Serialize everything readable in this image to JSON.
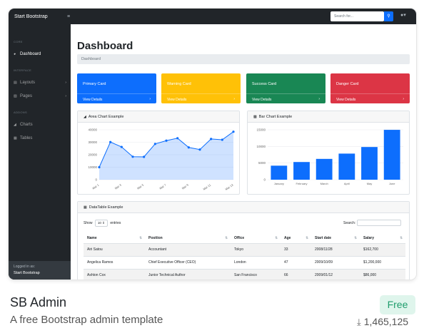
{
  "app": {
    "brand": "Start Bootstrap",
    "toggle_icon": "hamburger-icon",
    "search_placeholder": "Search for...",
    "search_icon": "search-icon",
    "user_icon": "user-icon"
  },
  "sidebar": {
    "sections": [
      {
        "heading": "Core",
        "items": [
          {
            "label": "Dashboard",
            "icon": "tachometer-icon",
            "active": true
          }
        ]
      },
      {
        "heading": "Interface",
        "items": [
          {
            "label": "Layouts",
            "icon": "columns-icon"
          },
          {
            "label": "Pages",
            "icon": "book-icon"
          }
        ]
      },
      {
        "heading": "Addons",
        "items": [
          {
            "label": "Charts",
            "icon": "chart-area-icon"
          },
          {
            "label": "Tables",
            "icon": "table-icon"
          }
        ]
      }
    ],
    "footer_label": "Logged in as:",
    "footer_value": "Start Bootstrap"
  },
  "main": {
    "title": "Dashboard",
    "breadcrumb": "Dashboard",
    "cards": [
      {
        "title": "Primary Card",
        "link": "View Details",
        "color": "#0d6efd"
      },
      {
        "title": "Warning Card",
        "link": "View Details",
        "color": "#ffc107"
      },
      {
        "title": "Success Card",
        "link": "View Details",
        "color": "#198754"
      },
      {
        "title": "Danger Card",
        "link": "View Details",
        "color": "#dc3545"
      }
    ],
    "area_title": "Area Chart Example",
    "bar_title": "Bar Chart Example",
    "table_title": "DataTable Example",
    "show_label": "Show",
    "entries_value": "10",
    "entries_label": "entries",
    "search_label": "Search:",
    "columns": [
      "Name",
      "Position",
      "Office",
      "Age",
      "Start date",
      "Salary"
    ],
    "rows": [
      [
        "Airi Satou",
        "Accountant",
        "Tokyo",
        "33",
        "2008/11/28",
        "$162,700"
      ],
      [
        "Angelica Ramos",
        "Chief Executive Officer (CEO)",
        "London",
        "47",
        "2009/10/09",
        "$1,200,000"
      ],
      [
        "Ashton Cox",
        "Junior Technical Author",
        "San Francisco",
        "66",
        "2009/01/12",
        "$86,000"
      ]
    ]
  },
  "listing": {
    "title": "SB Admin",
    "subtitle": "A free Bootstrap admin template",
    "badge": "Free",
    "downloads": "1,465,125",
    "download_icon": "download-icon"
  },
  "chart_data": [
    {
      "type": "area",
      "title": "Area Chart Example",
      "x": [
        "Mar 1",
        "Mar 2",
        "Mar 3",
        "Mar 4",
        "Mar 5",
        "Mar 6",
        "Mar 7",
        "Mar 8",
        "Mar 9",
        "Mar 10",
        "Mar 11",
        "Mar 12",
        "Mar 13"
      ],
      "x_tick_labels": [
        "Mar 1",
        "Mar 3",
        "Mar 5",
        "Mar 7",
        "Mar 9",
        "Mar 11",
        "Mar 13"
      ],
      "values": [
        10000,
        30162,
        26263,
        18394,
        18287,
        28682,
        31274,
        33259,
        25849,
        24159,
        32651,
        31984,
        38451
      ],
      "ylim": [
        0,
        40000
      ],
      "y_ticks": [
        "0",
        "10000",
        "20000",
        "30000",
        "40000"
      ],
      "color": "#0d6efd"
    },
    {
      "type": "bar",
      "title": "Bar Chart Example",
      "categories": [
        "January",
        "February",
        "March",
        "April",
        "May",
        "June"
      ],
      "values": [
        4215,
        5312,
        6251,
        7841,
        9821,
        14984
      ],
      "ylim": [
        0,
        15000
      ],
      "y_ticks": [
        "0",
        "5000",
        "10000",
        "15000"
      ],
      "color": "#0d6efd"
    }
  ]
}
